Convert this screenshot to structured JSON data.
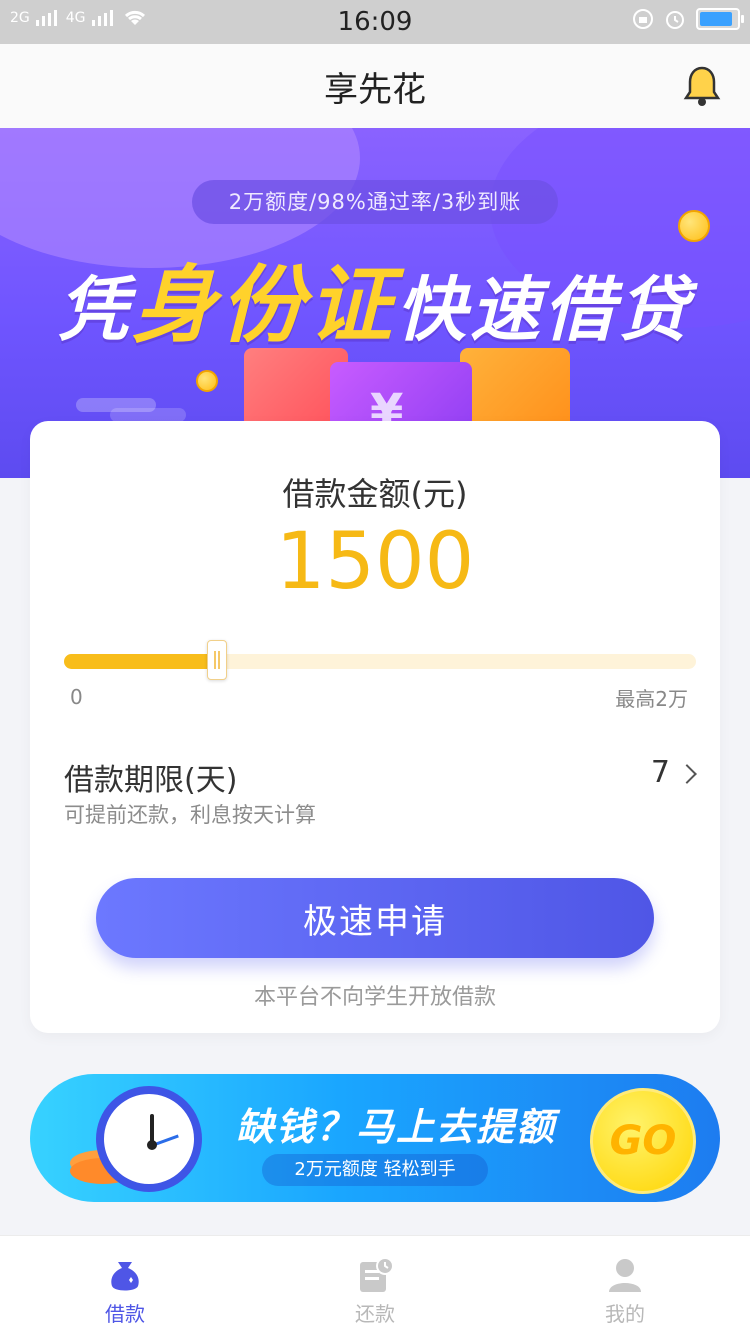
{
  "status_bar": {
    "time": "16:09",
    "signal_left": "2G",
    "signal_right": "4G"
  },
  "nav": {
    "title": "享先花"
  },
  "banner": {
    "pill_text": "2万额度/98%通过率/3秒到账",
    "headline_start": "凭",
    "headline_highlight": "身份证",
    "headline_end": "快速借贷"
  },
  "loan_card": {
    "amount_label": "借款金额(元)",
    "amount_value": "1500",
    "slider": {
      "value_fraction": 0.24,
      "min_label": "0",
      "max_label": "最高2万"
    },
    "term": {
      "title": "借款期限(天)",
      "subtitle": "可提前还款，利息按天计算",
      "value": "7"
    },
    "apply_button": "极速申请",
    "notice": "本平台不向学生开放借款"
  },
  "promo": {
    "title": "缺钱？马上去提额",
    "subtitle": "2万元额度 轻松到手",
    "go_label": "GO"
  },
  "tabbar": {
    "items": [
      {
        "label": "借款",
        "icon": "money-bag-icon",
        "active": true
      },
      {
        "label": "还款",
        "icon": "bill-icon",
        "active": false
      },
      {
        "label": "我的",
        "icon": "user-icon",
        "active": false
      }
    ]
  },
  "colors": {
    "accent": "#4f56e6",
    "amount": "#f6b915",
    "slider": "#f8bd1b"
  }
}
